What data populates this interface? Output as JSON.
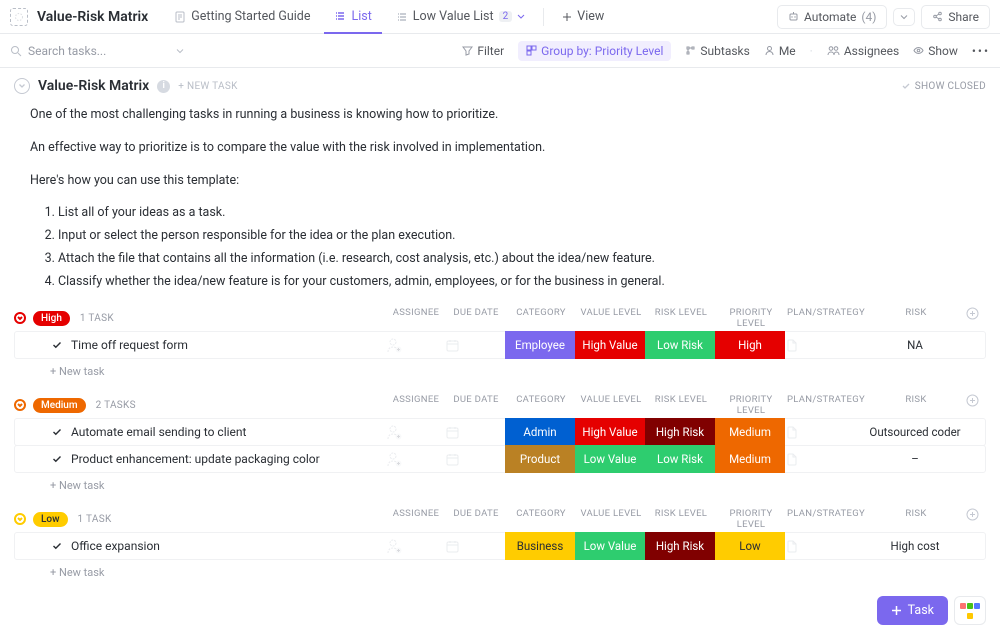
{
  "topbar": {
    "title": "Value-Risk Matrix",
    "tabs": {
      "guide": "Getting Started Guide",
      "list": "List",
      "lowvalue": "Low Value List",
      "lowvalue_count": "2",
      "view": "View"
    },
    "automate": "Automate",
    "automate_count": "(4)",
    "share": "Share"
  },
  "filterbar": {
    "search_placeholder": "Search tasks...",
    "filter": "Filter",
    "group_by": "Group by: Priority Level",
    "subtasks": "Subtasks",
    "me": "Me",
    "assignees": "Assignees",
    "show": "Show"
  },
  "listHeader": {
    "title": "Value-Risk Matrix",
    "new_task": "+ NEW TASK",
    "show_closed": "SHOW CLOSED"
  },
  "desc": {
    "p1": "One of the most challenging tasks in running a business is knowing how to prioritize.",
    "p2": "An effective way to prioritize is to compare the value with the risk involved in implementation.",
    "p3": "Here's how you can use this template:",
    "li1": "List all of your ideas as a task.",
    "li2": "Input or select the person responsible for the idea or the plan execution.",
    "li3": "Attach the file that contains all the information (i.e. research, cost analysis, etc.) about the idea/new feature.",
    "li4": "Classify whether the idea/new feature is for your customers, admin, employees, or for the business in general."
  },
  "columns": {
    "assignee": "ASSIGNEE",
    "due_date": "DUE DATE",
    "category": "CATEGORY",
    "value_level": "VALUE LEVEL",
    "risk_level": "RISK LEVEL",
    "priority_level": "PRIORITY LEVEL",
    "plan": "PLAN/STRATEGY",
    "risk": "RISK"
  },
  "labels": {
    "new_task_row": "+ New task"
  },
  "colors": {
    "high": "#e50000",
    "medium": "#ee6800",
    "low": "#ffcc00",
    "employee": "#7b68ee",
    "admin": "#0060d1",
    "product": "#ba8124",
    "business": "#ffcc00",
    "high_value": "#e50000",
    "low_value": "#2ecd6f",
    "low_risk": "#2ecd6f",
    "high_risk": "#800000"
  },
  "groups": [
    {
      "name": "High",
      "badge_color": "#e50000",
      "chev_color": "#e50000",
      "count": "1 TASK",
      "tasks": [
        {
          "title": "Time off request form",
          "category": "Employee",
          "category_color": "#7b68ee",
          "value": "High Value",
          "value_color": "#e50000",
          "riskl": "Low Risk",
          "riskl_color": "#2ecd6f",
          "priority": "High",
          "priority_color": "#e50000",
          "risk": "NA"
        }
      ]
    },
    {
      "name": "Medium",
      "badge_color": "#ee6800",
      "chev_color": "#ee6800",
      "count": "2 TASKS",
      "tasks": [
        {
          "title": "Automate email sending to client",
          "category": "Admin",
          "category_color": "#0060d1",
          "value": "High Value",
          "value_color": "#e50000",
          "riskl": "High Risk",
          "riskl_color": "#800000",
          "priority": "Medium",
          "priority_color": "#ee6800",
          "risk": "Outsourced coder"
        },
        {
          "title": "Product enhancement: update packaging color",
          "category": "Product",
          "category_color": "#ba8124",
          "value": "Low Value",
          "value_color": "#2ecd6f",
          "riskl": "Low Risk",
          "riskl_color": "#2ecd6f",
          "priority": "Medium",
          "priority_color": "#ee6800",
          "risk": "–"
        }
      ]
    },
    {
      "name": "Low",
      "badge_color": "#ffcc00",
      "chev_color": "#ffcc00",
      "count": "1 TASK",
      "tasks": [
        {
          "title": "Office expansion",
          "category": "Business",
          "category_color": "#ffcc00",
          "value": "Low Value",
          "value_color": "#2ecd6f",
          "riskl": "High Risk",
          "riskl_color": "#800000",
          "priority": "Low",
          "priority_color": "#ffcc00",
          "risk": "High cost"
        }
      ]
    }
  ],
  "fab": {
    "task": "Task"
  }
}
